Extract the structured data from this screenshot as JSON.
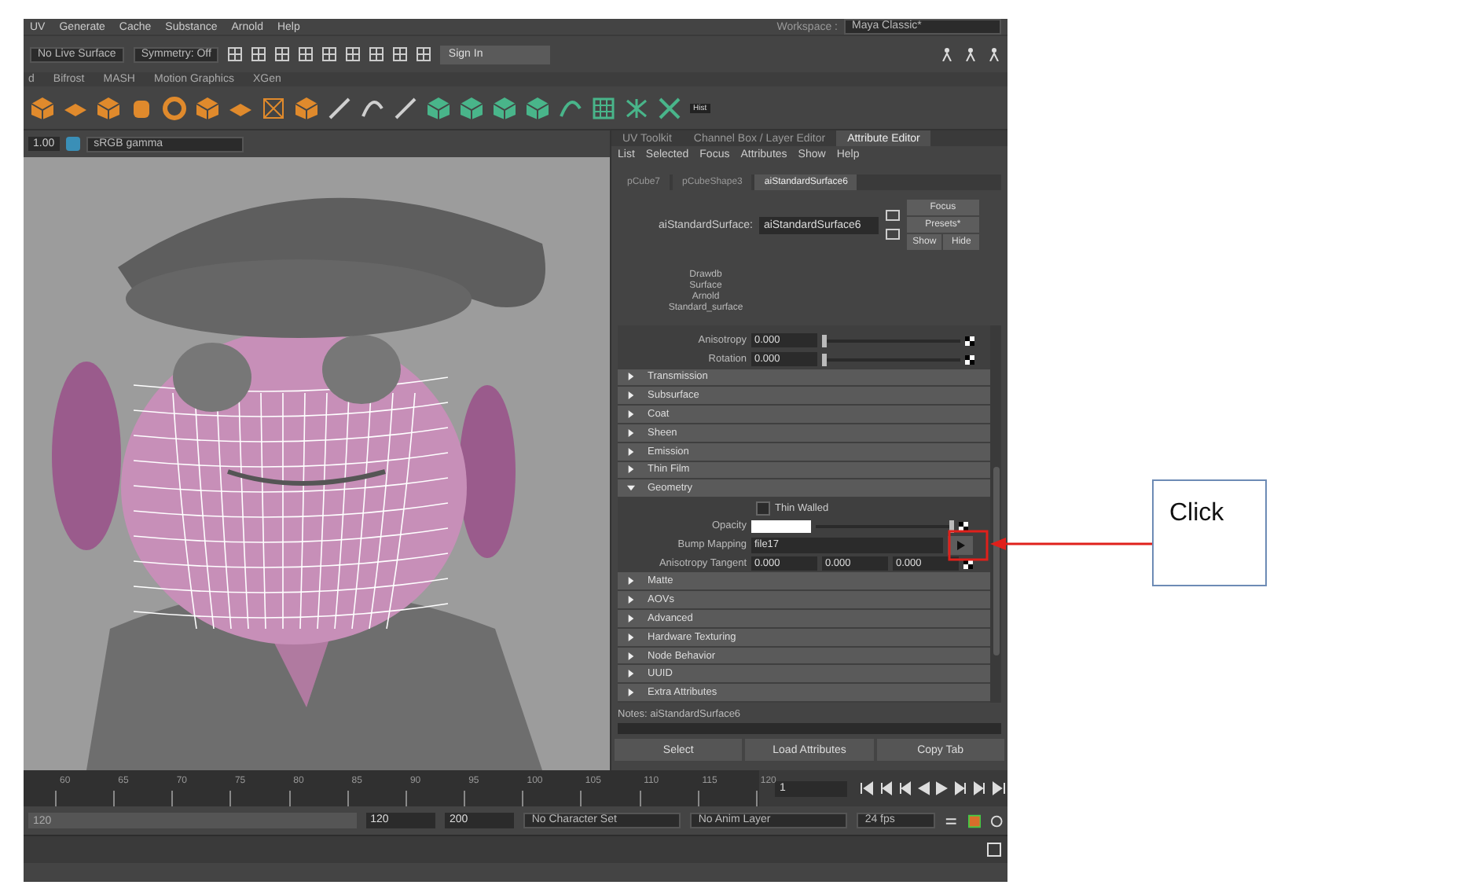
{
  "menu_bar": {
    "items": [
      "UV",
      "Generate",
      "Cache",
      "Substance",
      "Arnold",
      "Help"
    ],
    "workspace_label": "Workspace :",
    "workspace": "Maya Classic*"
  },
  "status_line": {
    "live_surface": "No Live Surface",
    "symmetry": "Symmetry: Off",
    "sign_in": "Sign In"
  },
  "shelf": {
    "tabs": [
      "d",
      "Bifrost",
      "MASH",
      "Motion Graphics",
      "XGen"
    ],
    "hist_label": "Hist"
  },
  "viewport": {
    "gamma_value": "1.00",
    "color_space": "sRGB gamma"
  },
  "attribute_editor": {
    "panel_tabs": [
      {
        "label": "UV Toolkit",
        "selected": false
      },
      {
        "label": "Channel Box / Layer Editor",
        "selected": false
      },
      {
        "label": "Attribute Editor",
        "selected": true
      }
    ],
    "menu": [
      "List",
      "Selected",
      "Focus",
      "Attributes",
      "Show",
      "Help"
    ],
    "node_tabs": [
      {
        "label": "pCube7",
        "selected": false
      },
      {
        "label": "pCubeShape3",
        "selected": false
      },
      {
        "label": "aiStandardSurface6",
        "selected": true
      }
    ],
    "node_label": "aiStandardSurface:",
    "node_name": "aiStandardSurface6",
    "focus_button": "Focus",
    "presets_button": "Presets*",
    "show_button": "Show",
    "hide_button": "Hide",
    "classification": [
      "Drawdb",
      "Surface",
      "Arnold",
      "Standard_surface"
    ],
    "sliders": [
      {
        "label": "Anisotropy",
        "value": "0.000",
        "level": 0
      },
      {
        "label": "Rotation",
        "value": "0.000",
        "level": 0
      }
    ],
    "sections": [
      {
        "title": "Transmission",
        "expanded": false
      },
      {
        "title": "Subsurface",
        "expanded": false
      },
      {
        "title": "Coat",
        "expanded": false
      },
      {
        "title": "Sheen",
        "expanded": false
      },
      {
        "title": "Emission",
        "expanded": false
      },
      {
        "title": "Thin Film",
        "expanded": false
      },
      {
        "title": "Geometry",
        "expanded": true,
        "attributes": [
          {
            "kind": "checkbox",
            "label": "Thin Walled",
            "checked": false
          },
          {
            "kind": "color_slider",
            "label": "Opacity",
            "level": 1
          },
          {
            "kind": "texture",
            "label": "Bump Mapping",
            "value": "file17"
          },
          {
            "kind": "vector",
            "label": "Anisotropy Tangent",
            "values": [
              "0.000",
              "0.000",
              "0.000"
            ]
          }
        ]
      },
      {
        "title": "Matte",
        "expanded": false
      },
      {
        "title": "AOVs",
        "expanded": false
      },
      {
        "title": "Advanced",
        "expanded": false
      },
      {
        "title": "Hardware Texturing",
        "expanded": false
      },
      {
        "title": "Node Behavior",
        "expanded": false
      },
      {
        "title": "UUID",
        "expanded": false
      },
      {
        "title": "Extra Attributes",
        "expanded": false
      }
    ],
    "notes_label": "Notes:  aiStandardSurface6",
    "bottom_buttons": [
      "Select",
      "Load Attributes",
      "Copy Tab"
    ]
  },
  "timeline": {
    "ticks": [
      "60",
      "65",
      "70",
      "75",
      "80",
      "85",
      "90",
      "95",
      "100",
      "105",
      "110",
      "115",
      "120"
    ],
    "current_frame": "1"
  },
  "range_slider": {
    "start": "120",
    "range_start": "120",
    "range_end": "200",
    "character_set": "No Character Set",
    "anim_layer": "No Anim Layer",
    "fps": "24 fps"
  },
  "callout": {
    "text": "Click"
  }
}
